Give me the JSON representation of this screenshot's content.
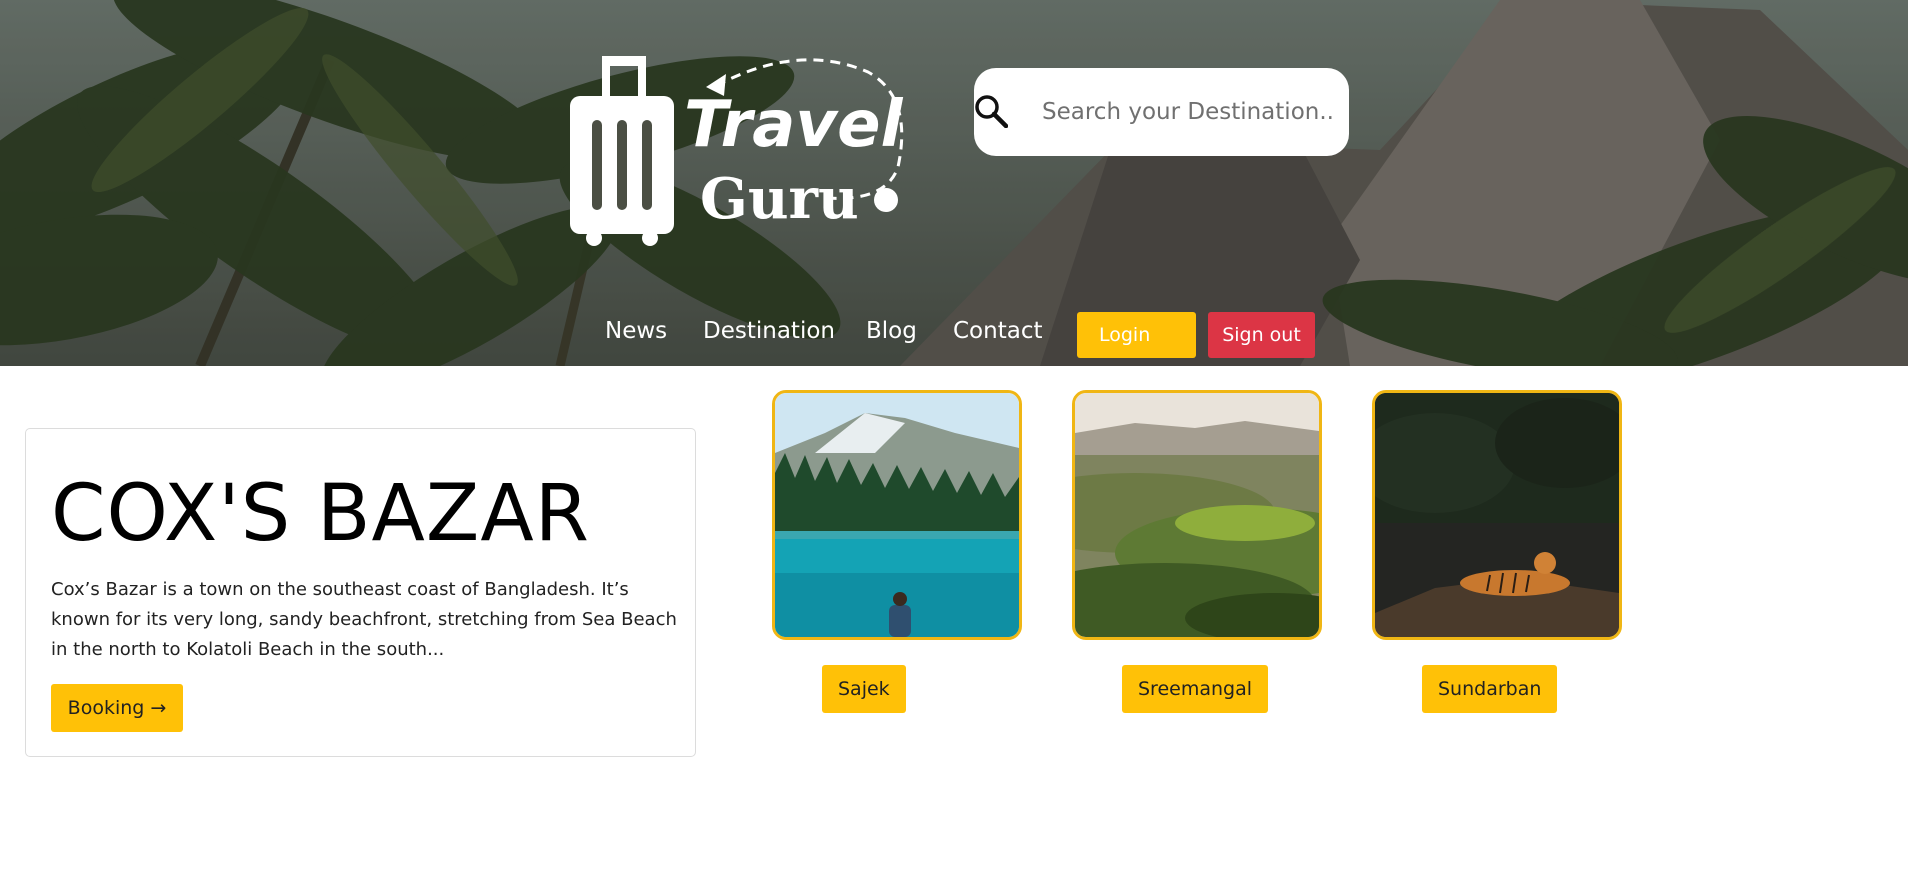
{
  "brand": {
    "line1": "Travel",
    "line2": "Guru"
  },
  "search": {
    "placeholder": "Search your Destination..."
  },
  "nav": {
    "items": [
      "News",
      "Destination",
      "Blog",
      "Contact"
    ],
    "login_label": "Login",
    "signout_label": "Sign out"
  },
  "feature": {
    "title": "COX'S BAZAR",
    "description": "Cox’s Bazar is a town on the southeast coast of Bangladesh. It’s known for its very long, sandy beachfront, stretching from Sea Beach in the north to Kolatoli Beach in the south...",
    "booking_label": "Booking →"
  },
  "destinations": [
    {
      "label": "Sajek"
    },
    {
      "label": "Sreemangal"
    },
    {
      "label": "Sundarban"
    }
  ],
  "colors": {
    "accent": "#ffc107",
    "danger": "#dc3545",
    "card_border": "#f0b614"
  }
}
